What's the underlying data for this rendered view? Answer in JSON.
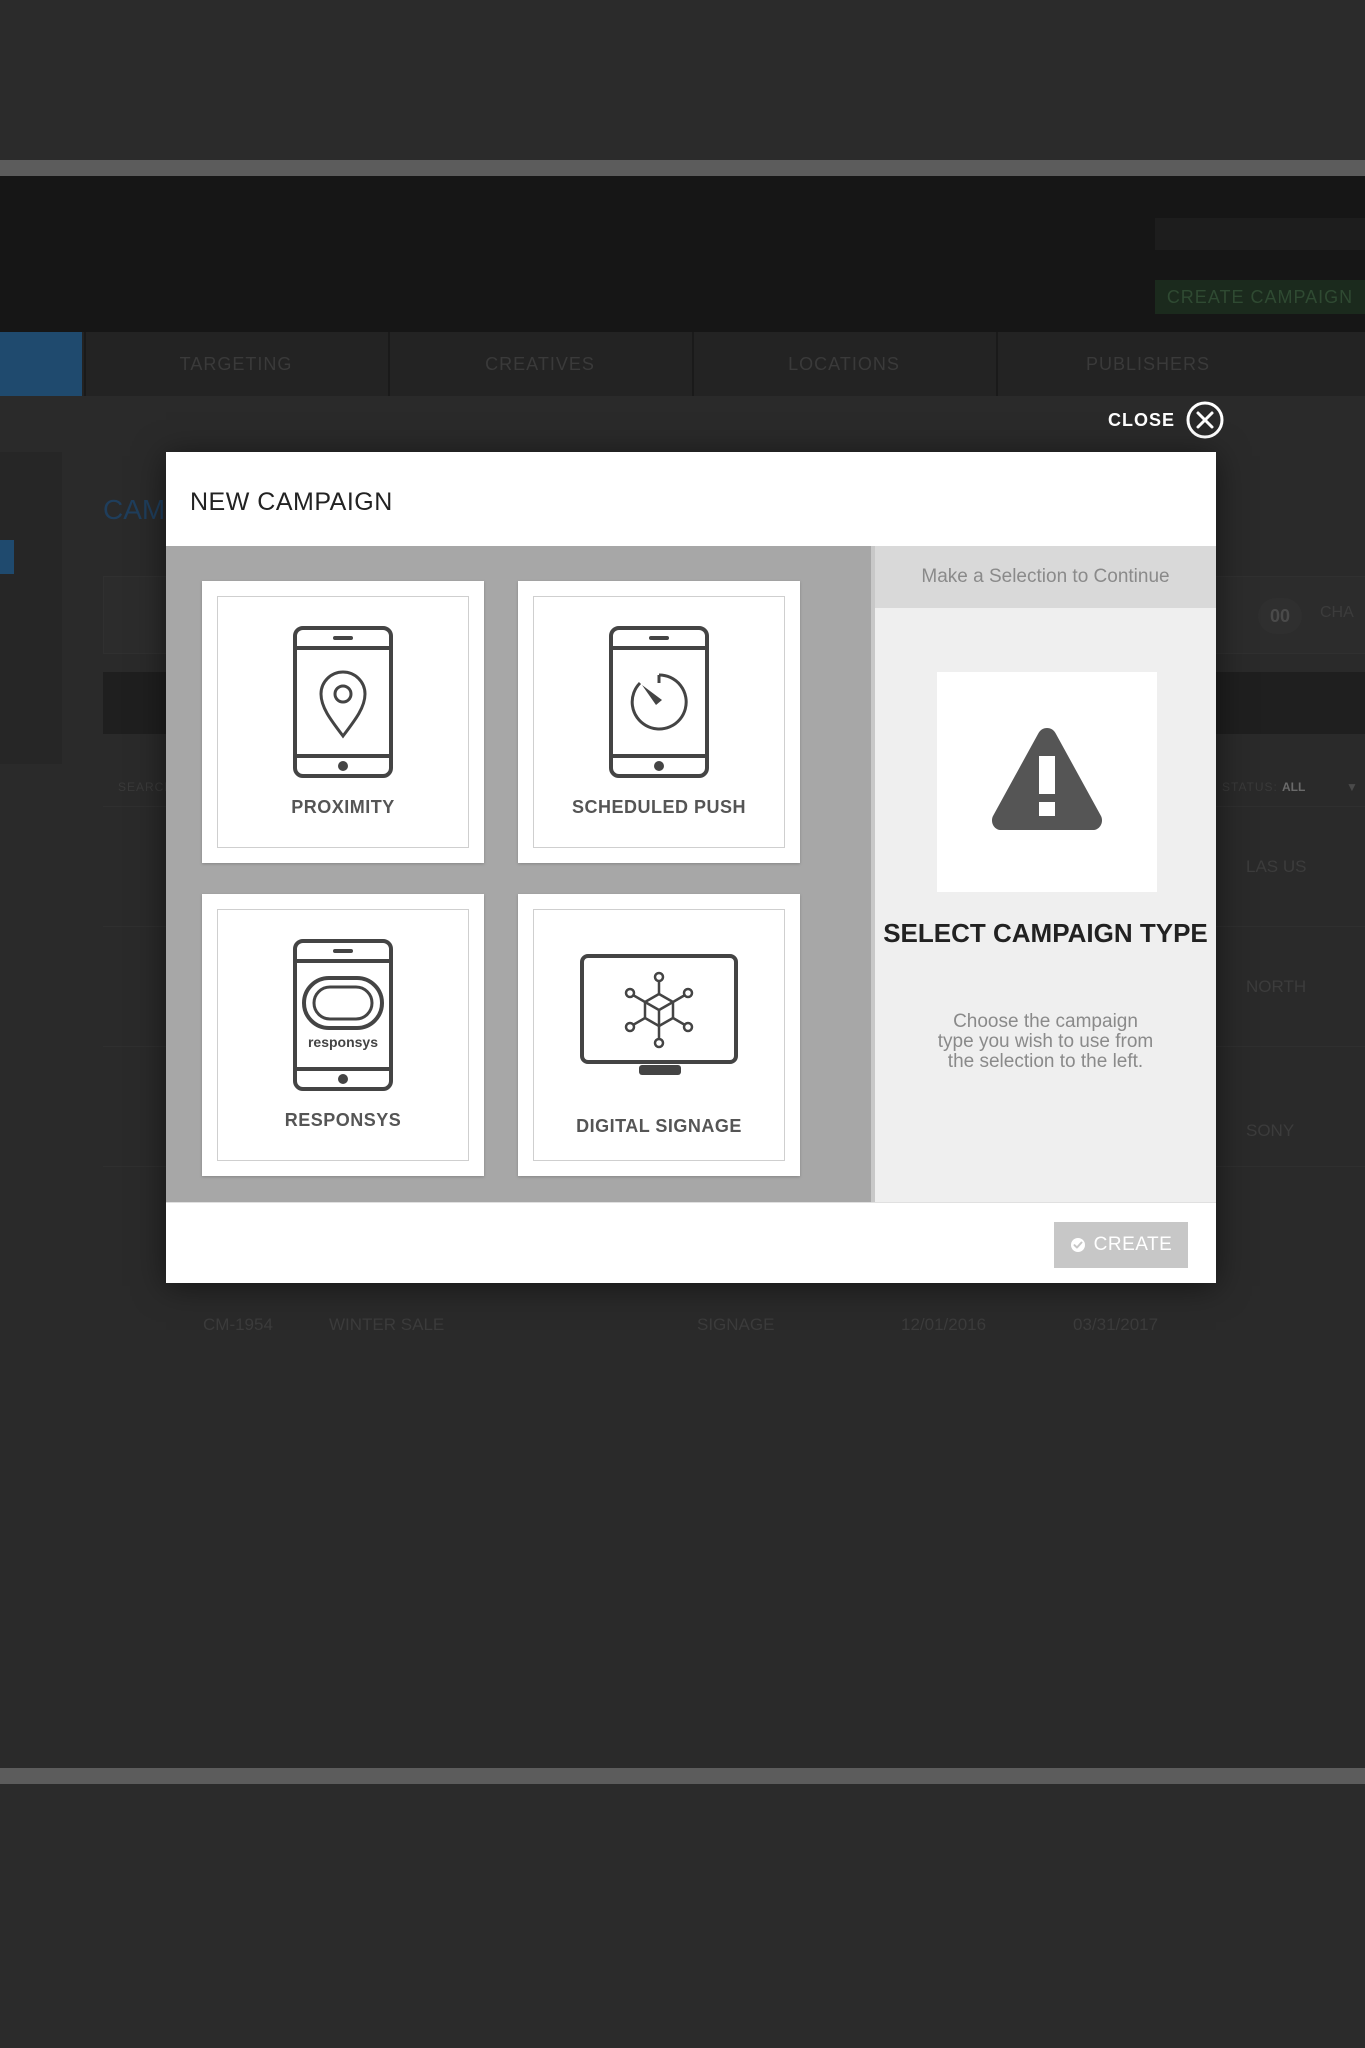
{
  "background": {
    "nav_tabs": [
      "TARGETING",
      "CREATIVES",
      "LOCATIONS",
      "PUBLISHERS"
    ],
    "header_button": "CREATE CAMPAIGN",
    "page_title": "CAM",
    "count": "00",
    "count_label": "CHA",
    "search_label": "SEARCH",
    "status_label": "STATUS:",
    "status_value": "ALL",
    "rows": [
      {
        "col_a": "",
        "col_b": "",
        "col_c": "",
        "col_d": "",
        "col_e": "",
        "region": "LAS US"
      },
      {
        "col_a": "",
        "col_b": "",
        "col_c": "",
        "col_d": "",
        "col_e": "",
        "region": "NORTH"
      },
      {
        "col_a": "",
        "col_b": "",
        "col_c": "",
        "col_d": "",
        "col_e": "",
        "region": "SONY"
      },
      {
        "col_a": "CM-1954",
        "col_b": "WINTER SALE",
        "col_c": "SIGNAGE",
        "col_d": "12/01/2016",
        "col_e": "03/31/2017",
        "region": ""
      }
    ]
  },
  "close": {
    "label": "CLOSE"
  },
  "modal": {
    "title": "NEW CAMPAIGN",
    "options": [
      {
        "label": "PROXIMITY",
        "icon": "phone-location-pin-icon"
      },
      {
        "label": "SCHEDULED PUSH",
        "icon": "phone-timer-icon"
      },
      {
        "label": "RESPONSYS",
        "icon": "phone-responsys-icon",
        "icon_text": "responsys"
      },
      {
        "label": "DIGITAL SIGNAGE",
        "icon": "monitor-network-icon"
      }
    ],
    "summary": {
      "hint": "Make a Selection to Continue",
      "title": "SELECT CAMPAIGN TYPE",
      "description": "Choose the campaign type you wish to use from the selection to the left.",
      "icon": "warning-icon"
    },
    "create_button": {
      "label": "CREATE",
      "icon": "check-circle-icon"
    }
  },
  "colors": {
    "backdrop": "#2a2a2a",
    "options_bg": "#a7a7a7",
    "icon_stroke": "#444444",
    "disabled_button": "#c7c7c7"
  }
}
